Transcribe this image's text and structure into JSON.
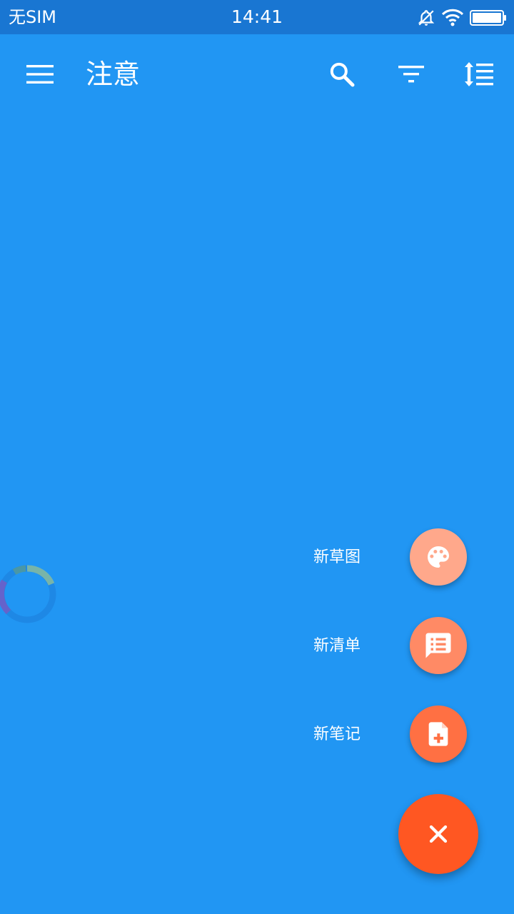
{
  "status_bar": {
    "carrier": "无SIM",
    "time": "14:41",
    "icons": [
      "notifications-off-icon",
      "wifi-icon",
      "battery-full-icon"
    ]
  },
  "toolbar": {
    "title": "注意",
    "icons": [
      "menu-icon",
      "search-icon",
      "filter-icon",
      "sort-icon"
    ]
  },
  "speed_dial": {
    "items": [
      {
        "label": "新草图",
        "icon": "palette-icon",
        "color": "#FFA88B"
      },
      {
        "label": "新清单",
        "icon": "checklist-icon",
        "color": "#FF8A65"
      },
      {
        "label": "新笔记",
        "icon": "new-note-icon",
        "color": "#FF7043"
      }
    ],
    "main_fab": {
      "icon": "close-icon",
      "color": "#FF5722"
    }
  },
  "colors": {
    "background": "#2196F3",
    "status_bar": "#1976D2",
    "text": "#FFFFFF"
  }
}
